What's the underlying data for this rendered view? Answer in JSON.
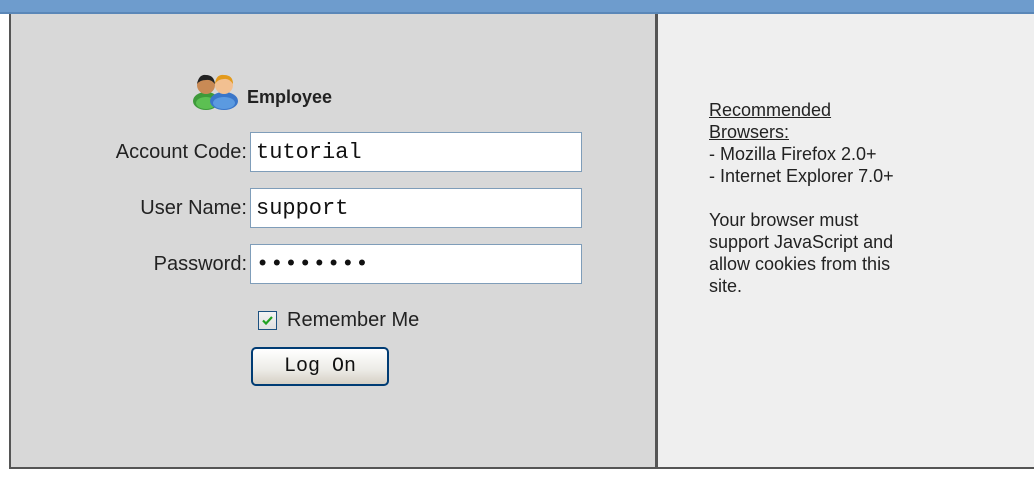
{
  "login_form": {
    "role_label": "Employee",
    "account_code": {
      "label": "Account Code:",
      "value": "tutorial"
    },
    "user_name": {
      "label": "User Name:",
      "value": "support"
    },
    "password": {
      "label": "Password:",
      "value": "password"
    },
    "remember_me": {
      "label": "Remember Me",
      "checked": true
    },
    "logon_button": "Log On"
  },
  "browser_info": {
    "heading_line1": "Recommended",
    "heading_line2": "Browsers:",
    "browsers": [
      "- Mozilla Firefox 2.0+",
      "- Internet Explorer 7.0+"
    ],
    "notice_lines": [
      "Your browser must",
      "support JavaScript and",
      "allow cookies from this",
      "site."
    ]
  },
  "icons": {
    "employee": "users-icon",
    "checkbox": "checkmark-icon"
  },
  "colors": {
    "top_bar": "#6e9ccd",
    "left_pane": "#d8d8d8",
    "right_pane": "#efefef",
    "border": "#555555"
  }
}
